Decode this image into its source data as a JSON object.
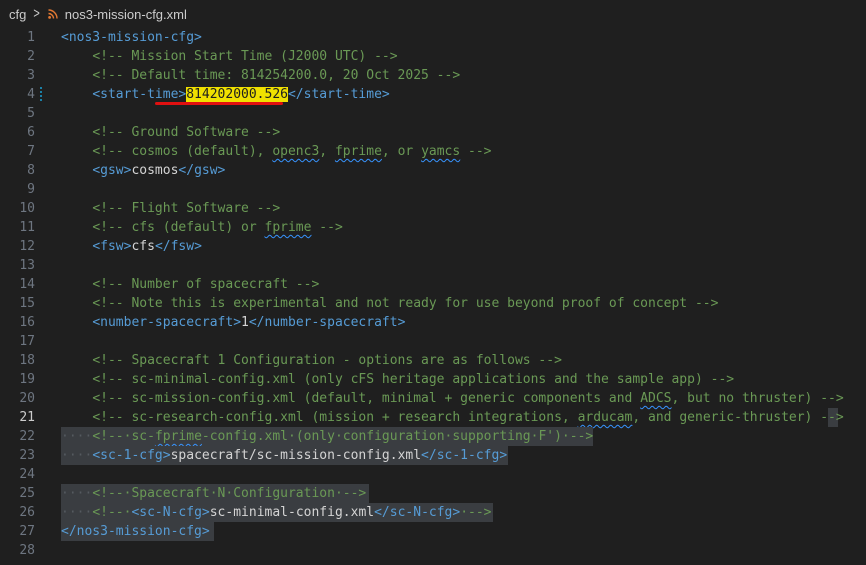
{
  "breadcrumb": {
    "folder": "cfg",
    "file": "nos3-mission-cfg.xml"
  },
  "editor": {
    "active_line": 21,
    "lines": [
      {
        "num": "1",
        "segs": [
          [
            "t",
            "<nos3-mission-cfg>"
          ]
        ]
      },
      {
        "num": "2",
        "segs": [
          [
            "ws",
            "    "
          ],
          [
            "c",
            "<!-- Mission Start Time (J2000 UTC) -->"
          ]
        ]
      },
      {
        "num": "3",
        "segs": [
          [
            "ws",
            "    "
          ],
          [
            "c",
            "<!-- Default time: 814254200.0, 20 Oct 2025 -->"
          ]
        ]
      },
      {
        "num": "4",
        "segs": [
          [
            "ws",
            "    "
          ],
          [
            "t",
            "<start-time>"
          ],
          [
            "hl",
            "814202000.526"
          ],
          [
            "t",
            "</start-time>"
          ]
        ]
      },
      {
        "num": "5",
        "segs": []
      },
      {
        "num": "6",
        "segs": [
          [
            "ws",
            "    "
          ],
          [
            "c",
            "<!-- Ground Software -->"
          ]
        ]
      },
      {
        "num": "7",
        "segs": [
          [
            "ws",
            "    "
          ],
          [
            "c",
            "<!-- cosmos (default), "
          ],
          [
            "csq",
            "openc3"
          ],
          [
            "c",
            ", "
          ],
          [
            "csq",
            "fprime"
          ],
          [
            "c",
            ", or "
          ],
          [
            "csq",
            "yamcs"
          ],
          [
            "c",
            " -->"
          ]
        ]
      },
      {
        "num": "8",
        "segs": [
          [
            "ws",
            "    "
          ],
          [
            "t",
            "<gsw>"
          ],
          [
            "tx",
            "cosmos"
          ],
          [
            "t",
            "</gsw>"
          ]
        ]
      },
      {
        "num": "9",
        "segs": []
      },
      {
        "num": "10",
        "segs": [
          [
            "ws",
            "    "
          ],
          [
            "c",
            "<!-- Flight Software -->"
          ]
        ]
      },
      {
        "num": "11",
        "segs": [
          [
            "ws",
            "    "
          ],
          [
            "c",
            "<!-- cfs (default) or "
          ],
          [
            "csq",
            "fprime"
          ],
          [
            "c",
            " -->"
          ]
        ]
      },
      {
        "num": "12",
        "segs": [
          [
            "ws",
            "    "
          ],
          [
            "t",
            "<fsw>"
          ],
          [
            "tx",
            "cfs"
          ],
          [
            "t",
            "</fsw>"
          ]
        ]
      },
      {
        "num": "13",
        "segs": []
      },
      {
        "num": "14",
        "segs": [
          [
            "ws",
            "    "
          ],
          [
            "c",
            "<!-- Number of spacecraft -->"
          ]
        ]
      },
      {
        "num": "15",
        "segs": [
          [
            "ws",
            "    "
          ],
          [
            "c",
            "<!-- Note this is experimental and not ready for use beyond proof of concept -->"
          ]
        ]
      },
      {
        "num": "16",
        "segs": [
          [
            "ws",
            "    "
          ],
          [
            "t",
            "<number-spacecraft>"
          ],
          [
            "tx",
            "1"
          ],
          [
            "t",
            "</number-spacecraft>"
          ]
        ]
      },
      {
        "num": "17",
        "segs": []
      },
      {
        "num": "18",
        "segs": [
          [
            "ws",
            "    "
          ],
          [
            "c",
            "<!-- Spacecraft 1 Configuration - options are as follows -->"
          ]
        ]
      },
      {
        "num": "19",
        "segs": [
          [
            "ws",
            "    "
          ],
          [
            "c",
            "<!-- sc-minimal-config.xml (only cFS heritage applications and the sample app) -->"
          ]
        ]
      },
      {
        "num": "20",
        "segs": [
          [
            "ws",
            "    "
          ],
          [
            "c",
            "<!-- sc-mission-config.xml (default, minimal + generic components and "
          ],
          [
            "csq",
            "ADCS"
          ],
          [
            "c",
            ", but no thruster) -->"
          ]
        ]
      },
      {
        "num": "21",
        "segs": [
          [
            "ws",
            "    "
          ],
          [
            "c",
            "<!-- sc-research-config.xml (mission + research integrations, "
          ],
          [
            "csq",
            "arducam"
          ],
          [
            "c",
            ", and generic-thruster) -->"
          ]
        ]
      },
      {
        "num": "22",
        "segs": [
          [
            "ws",
            "····"
          ],
          [
            "c",
            "<!--·sc-"
          ],
          [
            "csq",
            "fprime"
          ],
          [
            "c",
            "-config.xml·(only·configuration·supporting·F')·-->"
          ]
        ]
      },
      {
        "num": "23",
        "segs": [
          [
            "ws",
            "····"
          ],
          [
            "t",
            "<sc-1-cfg>"
          ],
          [
            "tx",
            "spacecraft/sc-mission-config.xml"
          ],
          [
            "t",
            "</sc-1-cfg>"
          ]
        ]
      },
      {
        "num": "24",
        "segs": []
      },
      {
        "num": "25",
        "segs": [
          [
            "ws",
            "····"
          ],
          [
            "c",
            "<!--·Spacecraft·N·Configuration·-->"
          ]
        ]
      },
      {
        "num": "26",
        "segs": [
          [
            "ws",
            "····"
          ],
          [
            "c",
            "<!--·"
          ],
          [
            "t",
            "<sc-N-cfg>"
          ],
          [
            "tx",
            "sc-minimal-config.xml"
          ],
          [
            "t",
            "</sc-N-cfg>"
          ],
          [
            "c",
            "·-->"
          ]
        ]
      },
      {
        "num": "27",
        "segs": [
          [
            "t",
            "</nos3-mission-cfg>"
          ]
        ]
      },
      {
        "num": "28",
        "segs": []
      }
    ]
  }
}
